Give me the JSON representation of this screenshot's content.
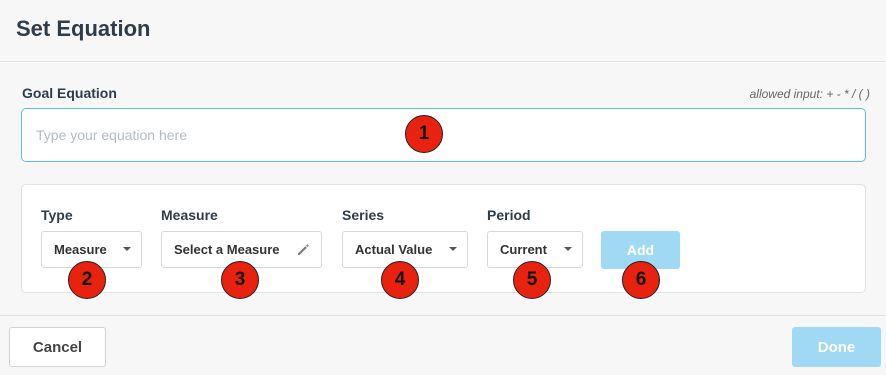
{
  "dialog": {
    "title": "Set Equation"
  },
  "goal_equation": {
    "label": "Goal Equation",
    "allowed_input": "allowed input: + - * / ( )",
    "placeholder": "Type your equation here",
    "value": ""
  },
  "fields": {
    "type": {
      "label": "Type",
      "value": "Measure"
    },
    "measure": {
      "label": "Measure",
      "value": "Select a Measure"
    },
    "series": {
      "label": "Series",
      "value": "Actual Value"
    },
    "period": {
      "label": "Period",
      "value": "Current"
    }
  },
  "buttons": {
    "add": "Add",
    "cancel": "Cancel",
    "done": "Done"
  },
  "markers": [
    "1",
    "2",
    "3",
    "4",
    "5",
    "6"
  ],
  "colors": {
    "accent_border": "#5bc0de",
    "disabled_primary": "#9fd9f3",
    "marker": "#e8220f"
  },
  "icons": {
    "select_caret": "chevron-down-icon",
    "measure_edit": "pencil-icon"
  }
}
